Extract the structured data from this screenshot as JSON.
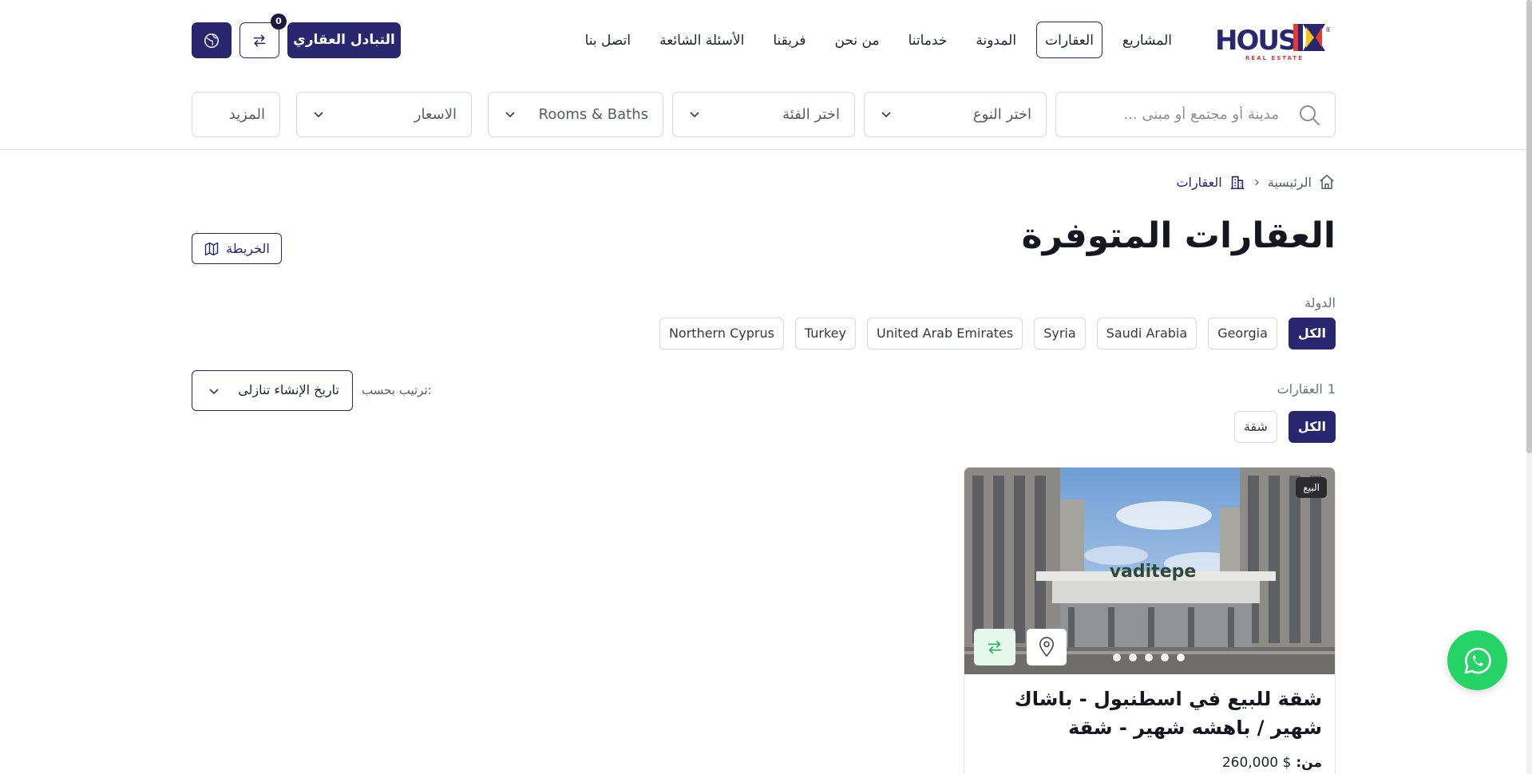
{
  "brand": {
    "logo_text_main": "HOUS",
    "logo_text_x": "X",
    "logo_subtitle": "REAL ESTATE",
    "colors": {
      "primary": "#29276f",
      "accent_red": "#e53935",
      "accent_yellow": "#f5c518",
      "whatsapp": "#25d366"
    }
  },
  "nav": {
    "items": [
      {
        "label": "المشاريع",
        "active": false
      },
      {
        "label": "العقارات",
        "active": true
      },
      {
        "label": "المدونة",
        "active": false
      },
      {
        "label": "خدماتنا",
        "active": false
      },
      {
        "label": "من نحن",
        "active": false
      },
      {
        "label": "فريقنا",
        "active": false
      },
      {
        "label": "الأسئلة الشائعة",
        "active": false
      },
      {
        "label": "اتصل بنا",
        "active": false
      }
    ],
    "exchange_label": "التبادل العقاري",
    "compare_count": "0",
    "compare_icon": "swap-arrows-icon",
    "language_icon": "globe-icon"
  },
  "filters": {
    "search_placeholder": "مدينة أو مجتمع أو مبنى ...",
    "type_label": "اختر النوع",
    "category_label": "اختر الفئة",
    "rooms_label": "Rooms & Baths",
    "prices_label": "الاسعار",
    "more_label": "المزيد"
  },
  "breadcrumb": {
    "home": "الرئيسية",
    "current": "العقارات"
  },
  "page_title": "العقارات المتوفرة",
  "map_button_label": "الخريطة",
  "country": {
    "label": "الدولة",
    "chips": [
      {
        "label": "الكل",
        "active": true
      },
      {
        "label": "Georgia",
        "active": false
      },
      {
        "label": "Saudi Arabia",
        "active": false
      },
      {
        "label": "Syria",
        "active": false
      },
      {
        "label": "United Arab Emirates",
        "active": false
      },
      {
        "label": "Turkey",
        "active": false
      },
      {
        "label": "Northern Cyprus",
        "active": false
      }
    ]
  },
  "results": {
    "count": "1",
    "count_label": "العقارات",
    "sort_label": "ترتيب بحسب:",
    "sort_value": "تاريخ الإنشاء تنازلى",
    "type_chips": [
      {
        "label": "الكل",
        "active": true
      },
      {
        "label": "شقة",
        "active": false
      }
    ]
  },
  "card": {
    "badge": "البيع",
    "image_sign": "vaditepe",
    "title": "شقة للبيع في اسطنبول - باشاك شهير / باهشه شهير - شقة",
    "price_prefix": "من:",
    "price_value": "$ 260,000",
    "slide_count": 5,
    "active_slide": 0
  }
}
